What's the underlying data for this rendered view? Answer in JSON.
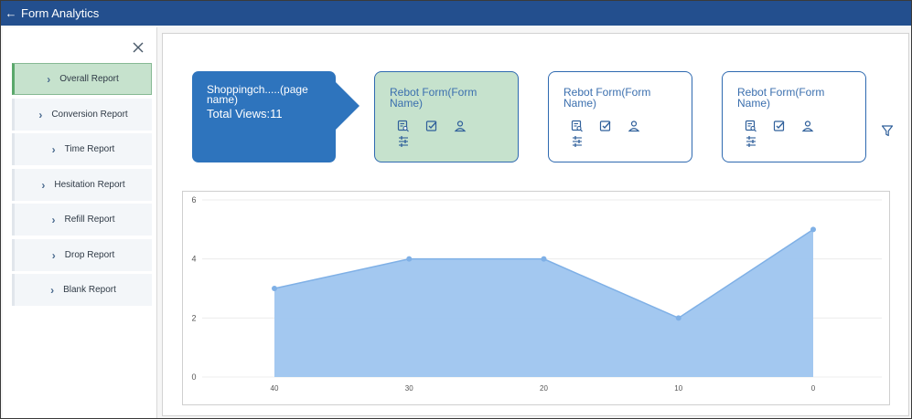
{
  "titlebar": {
    "back_icon": "arrow-left-icon",
    "title": "Form Analytics"
  },
  "sidebar": {
    "close_icon": "close-icon",
    "items": [
      {
        "label": "Overall Report",
        "active": true
      },
      {
        "label": "Conversion Report",
        "active": false
      },
      {
        "label": "Time Report",
        "active": false
      },
      {
        "label": "Hesitation Report",
        "active": false
      },
      {
        "label": "Refill Report",
        "active": false
      },
      {
        "label": "Drop Report",
        "active": false
      },
      {
        "label": "Blank Report",
        "active": false
      }
    ]
  },
  "page_card": {
    "name": "Shoppingch.....(page name)",
    "views": "Total Views:11"
  },
  "form_cards": [
    {
      "name": "Rebot Form(Form Name)",
      "active": true
    },
    {
      "name": "Rebot Form(Form Name)",
      "active": false
    },
    {
      "name": "Rebot Form(Form Name)",
      "active": false
    }
  ],
  "form_card_icons": [
    "search-list-icon",
    "checkbox-icon",
    "user-icon",
    "sliders-icon"
  ],
  "filter_icon": "filter-icon",
  "colors": {
    "titlebar": "#234f8e",
    "page_card": "#2e74bd",
    "active": "#c6e2cd",
    "area_fill": "#9ec5ef",
    "area_line": "#7fb0e6"
  },
  "chart_data": {
    "type": "area",
    "x": [
      "40",
      "30",
      "20",
      "10",
      "0"
    ],
    "values": [
      3,
      4,
      4,
      2,
      5
    ],
    "ylim": [
      0,
      6
    ],
    "yticks": [
      "0",
      "2",
      "4",
      "6"
    ],
    "grid": true,
    "title": "",
    "xlabel": "",
    "ylabel": ""
  }
}
